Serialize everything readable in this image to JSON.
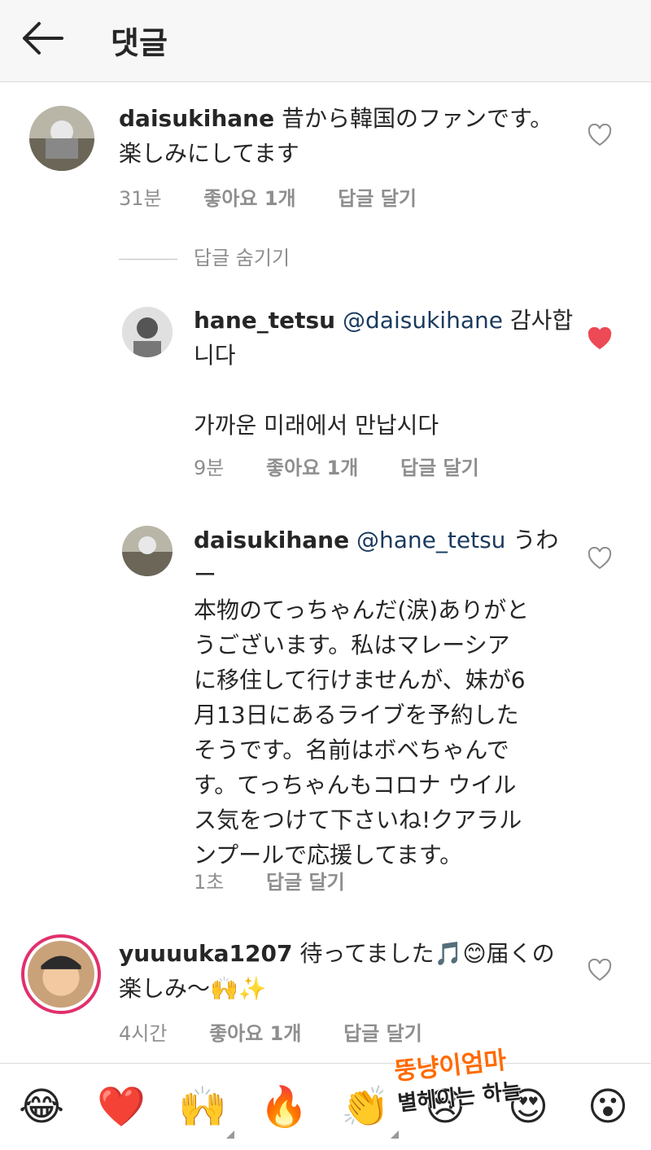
{
  "header": {
    "title": "댓글",
    "back_icon": "arrow-left-icon"
  },
  "comments": [
    {
      "username": "daisukihane",
      "text_lines": [
        "昔から韓国のファンです。",
        "楽しみにしてます"
      ],
      "time": "31분",
      "likes": "좋아요 1개",
      "reply": "답글 달기",
      "liked": false
    },
    {
      "username": "hane_tetsu",
      "mention": "@daisukihane",
      "text_lines": [
        "감사합",
        "니다",
        "",
        "가까운 미래에서 만납시다"
      ],
      "time": "9분",
      "likes": "좋아요 1개",
      "reply": "답글 달기",
      "liked": true
    },
    {
      "username": "daisukihane",
      "mention": "@hane_tetsu",
      "text_lines": [
        "うわー",
        "本物のてっちゃんだ(涙)ありがと",
        "うございます。私はマレーシア",
        "に移住して行けませんが、妹が6",
        "月13日にあるライブを予約した",
        "そうです。名前はボベちゃんで",
        "す。てっちゃんもコロナ ウイル",
        "ス気をつけて下さいね!クアラル",
        "ンプールで応援してます。"
      ],
      "time": "1초",
      "reply": "답글 달기",
      "liked": false
    },
    {
      "username": "yuuuuka1207",
      "text_lines": [
        "待ってました🎵😊届くの",
        "楽しみ〜🙌✨"
      ],
      "time": "4시간",
      "likes": "좋아요 1개",
      "reply": "답글 달기",
      "liked": false
    }
  ],
  "hide_replies": "답글 숨기기",
  "emoji_bar": [
    "😂",
    "❤️",
    "🙌",
    "🔥",
    "👏",
    "😢",
    "😍",
    "😮"
  ],
  "watermark": {
    "line1": "뚱냥이엄마",
    "line2": "별헤이는 하늘",
    "color": "#ff6a00"
  },
  "colors": {
    "liked_heart": "#ed4956",
    "meta_gray": "#8e8e8e",
    "mention": "#1a3a5f"
  }
}
